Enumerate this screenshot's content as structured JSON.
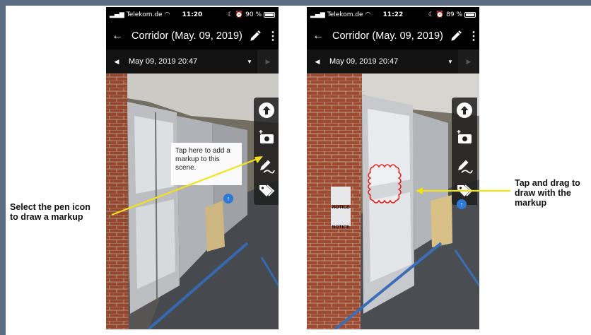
{
  "colors": {
    "accent_arrow": "#f5e11a",
    "markup_red": "#e02424",
    "hotspot_blue": "#2d7ad6"
  },
  "phones": [
    {
      "status": {
        "carrier": "Telekom.de",
        "time": "11:20",
        "battery": "90 %",
        "battery_level": 0.9
      },
      "appbar": {
        "title": "Corridor (May. 09, 2019)"
      },
      "datebar": {
        "date": "May 09, 2019 20:47"
      },
      "tooltip": "Tap here to add a markup to this scene."
    },
    {
      "status": {
        "carrier": "Telekom.de",
        "time": "11:22",
        "battery": "89 %",
        "battery_level": 0.89
      },
      "appbar": {
        "title": "Corridor (May. 09, 2019)"
      },
      "datebar": {
        "date": "May 09, 2019 20:47"
      },
      "notice_signs": [
        "NOTICE",
        "NOTICE"
      ]
    }
  ],
  "icons": {
    "back": "arrow-left-icon",
    "edit": "pencil-icon",
    "more": "kebab-menu-icon",
    "prev": "caret-left-icon",
    "dropdown": "caret-down-icon",
    "next": "caret-right-icon",
    "upload": "upload-arrow-icon",
    "add_photo": "add-photo-icon",
    "markup_pen": "markup-pen-icon",
    "tags": "tags-icon"
  },
  "callouts": {
    "left": "Select the pen icon to draw a markup",
    "right": "Tap and drag to draw with the markup"
  }
}
